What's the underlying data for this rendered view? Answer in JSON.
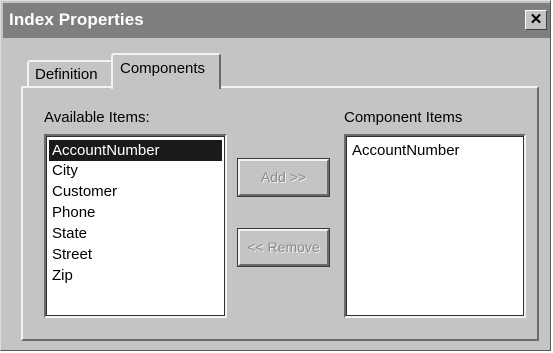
{
  "window": {
    "title": "Index Properties",
    "close_glyph": "✕"
  },
  "tabs": [
    {
      "label": "Definition",
      "active": false
    },
    {
      "label": "Components",
      "active": true
    }
  ],
  "available": {
    "label": "Available Items:",
    "items": [
      "AccountNumber",
      "City",
      "Customer",
      "Phone",
      "State",
      "Street",
      "Zip"
    ],
    "selected": "AccountNumber"
  },
  "component": {
    "label": "Component Items",
    "items": [
      "AccountNumber"
    ]
  },
  "buttons": {
    "add_label": "Add >>",
    "remove_label": "<< Remove",
    "add_enabled": false,
    "remove_enabled": false
  }
}
